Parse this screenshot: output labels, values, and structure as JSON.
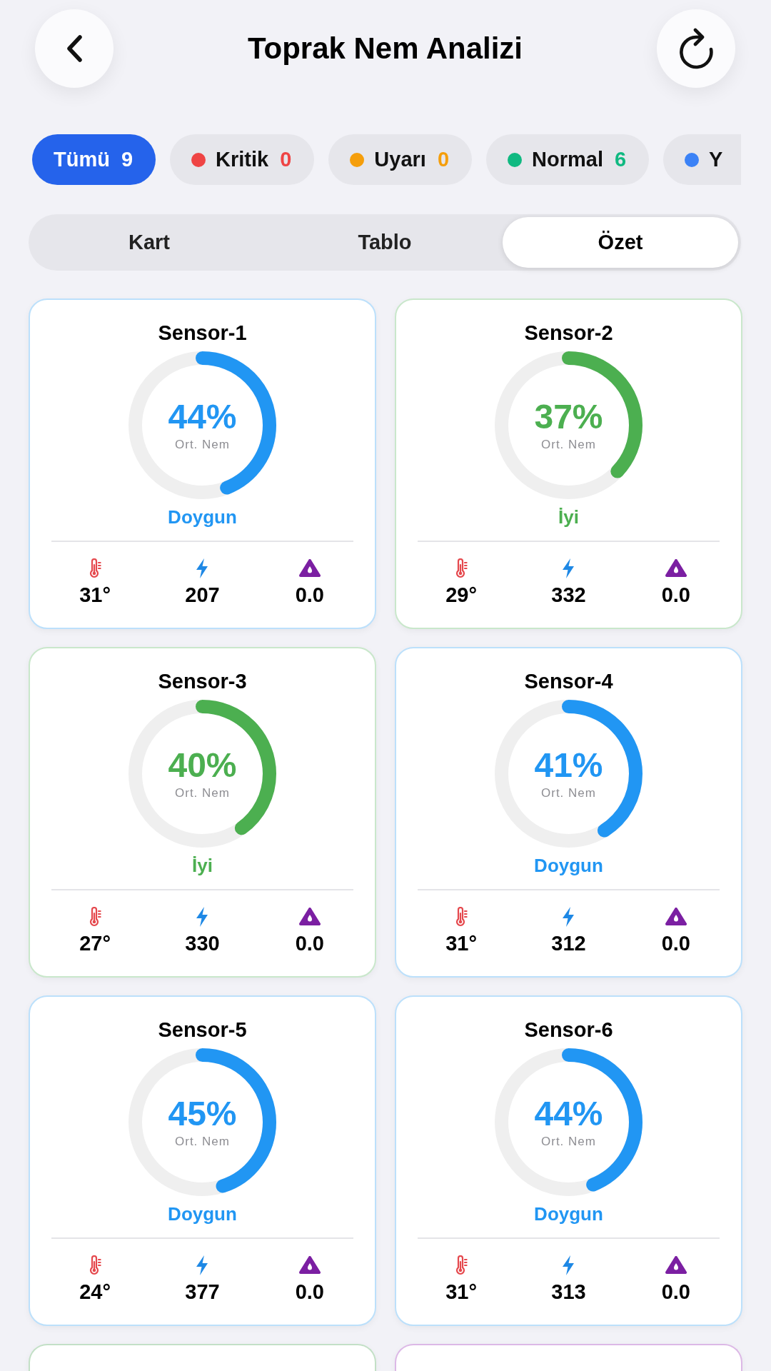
{
  "header": {
    "title": "Toprak Nem Analizi"
  },
  "filters": [
    {
      "label": "Tümü",
      "count": "9",
      "selected": true
    },
    {
      "label": "Kritik",
      "count": "0",
      "color": "#ef4444",
      "selected": false
    },
    {
      "label": "Uyarı",
      "count": "0",
      "color": "#f59e0b",
      "selected": false
    },
    {
      "label": "Normal",
      "count": "6",
      "color": "#10b981",
      "selected": false
    },
    {
      "label": "Y",
      "color": "#3b82f6",
      "selected": false
    }
  ],
  "view_tabs": [
    {
      "label": "Kart",
      "selected": false
    },
    {
      "label": "Tablo",
      "selected": false
    },
    {
      "label": "Özet",
      "selected": true
    }
  ],
  "sensors": [
    {
      "name": "Sensor-1",
      "percent": "44%",
      "caption": "Ort. Nem",
      "level": 0.44,
      "status": "Doygun",
      "color": "#2196f3",
      "metrics": [
        {
          "kind": "temperature",
          "value": "31°"
        },
        {
          "kind": "bolt",
          "value": "207"
        },
        {
          "kind": "drop",
          "value": "0.0"
        }
      ]
    },
    {
      "name": "Sensor-2",
      "percent": "37%",
      "caption": "Ort. Nem",
      "level": 0.37,
      "status": "İyi",
      "color": "#4caf50",
      "metrics": [
        {
          "kind": "temperature",
          "value": "29°"
        },
        {
          "kind": "bolt",
          "value": "332"
        },
        {
          "kind": "drop",
          "value": "0.0"
        }
      ]
    },
    {
      "name": "Sensor-3",
      "percent": "40%",
      "caption": "Ort. Nem",
      "level": 0.4,
      "status": "İyi",
      "color": "#4caf50",
      "metrics": [
        {
          "kind": "temperature",
          "value": "27°"
        },
        {
          "kind": "bolt",
          "value": "330"
        },
        {
          "kind": "drop",
          "value": "0.0"
        }
      ]
    },
    {
      "name": "Sensor-4",
      "percent": "41%",
      "caption": "Ort. Nem",
      "level": 0.41,
      "status": "Doygun",
      "color": "#2196f3",
      "metrics": [
        {
          "kind": "temperature",
          "value": "31°"
        },
        {
          "kind": "bolt",
          "value": "312"
        },
        {
          "kind": "drop",
          "value": "0.0"
        }
      ]
    },
    {
      "name": "Sensor-5",
      "percent": "45%",
      "caption": "Ort. Nem",
      "level": 0.45,
      "status": "Doygun",
      "color": "#2196f3",
      "metrics": [
        {
          "kind": "temperature",
          "value": "24°"
        },
        {
          "kind": "bolt",
          "value": "377"
        },
        {
          "kind": "drop",
          "value": "0.0"
        }
      ]
    },
    {
      "name": "Sensor-6",
      "percent": "44%",
      "caption": "Ort. Nem",
      "level": 0.44,
      "status": "Doygun",
      "color": "#2196f3",
      "metrics": [
        {
          "kind": "temperature",
          "value": "31°"
        },
        {
          "kind": "bolt",
          "value": "313"
        },
        {
          "kind": "drop",
          "value": "0.0"
        }
      ]
    }
  ],
  "more_sensors": [
    {
      "color": "#c3e0c6"
    },
    {
      "color": "#dcb8e6"
    }
  ]
}
